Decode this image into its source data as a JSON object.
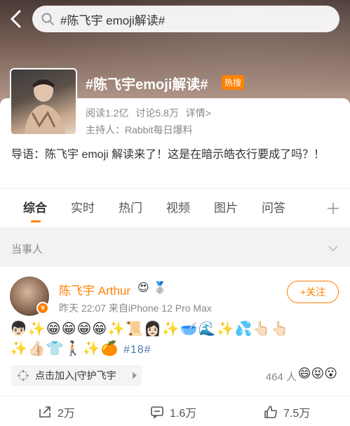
{
  "search": {
    "query": "#陈飞宇 emoji解读#"
  },
  "topic": {
    "title": "#陈飞宇emoji解读#",
    "badge": "热搜",
    "reads": "阅读1.2亿",
    "discussions": "讨论5.8万",
    "details": "详情>",
    "host": "主持人：Rabbit每日爆料",
    "intro": "导语：陈飞宇 emoji 解读来了！这是在暗示皓衣行要成了吗？！"
  },
  "tabs": [
    {
      "label": "综合",
      "active": true
    },
    {
      "label": "实时"
    },
    {
      "label": "热门"
    },
    {
      "label": "视频"
    },
    {
      "label": "图片"
    },
    {
      "label": "问答"
    }
  ],
  "section": {
    "label": "当事人"
  },
  "post": {
    "author": "陈飞宇 Arthur",
    "badge_heart": "😍",
    "badge_medal": "🥈",
    "verified_mark": "v",
    "meta": "昨天 22:07  来自iPhone 12 Pro Max",
    "follow_label": "+关注",
    "emoji_line_1": "👦🏻✨😁😁😁😁✨📜👩🏻✨🥣🌊✨💦👆🏻👆🏻",
    "emoji_line_2": "✨👍🏻👕🚶🏻✨🍊",
    "hashtag": "#18#",
    "join_label": "点击加入|守护飞宇",
    "people": "464 人",
    "people_emoji": "😄😝😮",
    "reposts": "2万",
    "comments": "1.6万",
    "likes": "7.5万"
  },
  "accent_color": "#ff8200",
  "link_color": "#507daf"
}
